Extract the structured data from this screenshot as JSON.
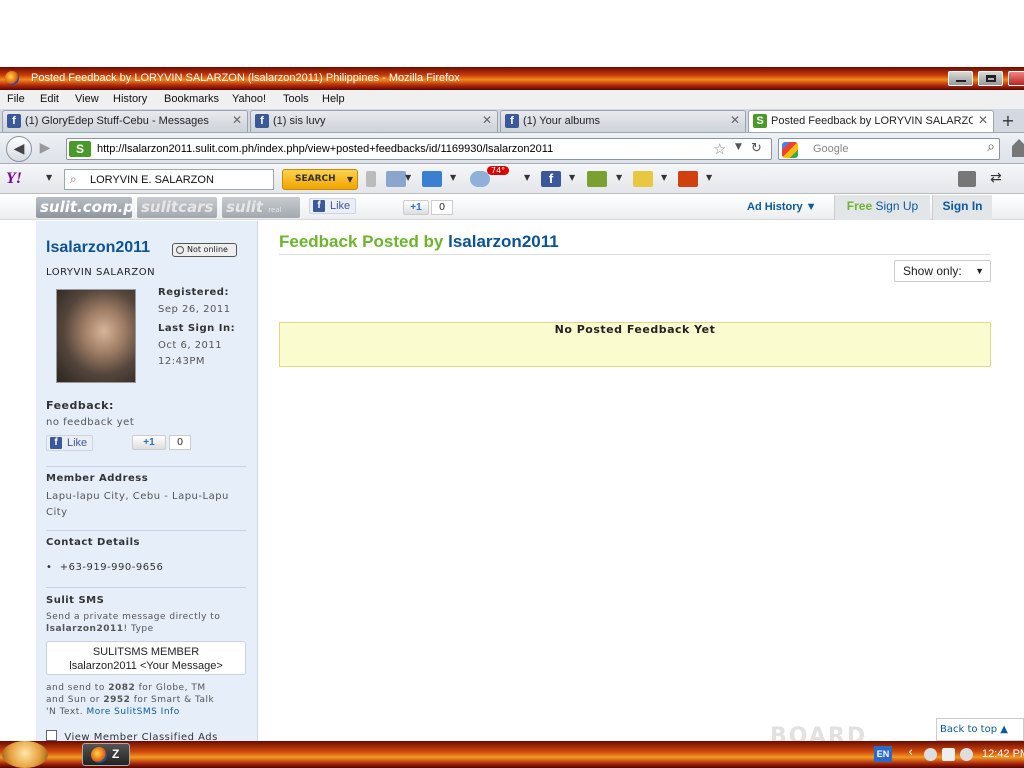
{
  "window": {
    "title": "Posted Feedback by LORYVIN SALARZON (lsalarzon2011) Philippines - Mozilla Firefox"
  },
  "menu": [
    "File",
    "Edit",
    "View",
    "History",
    "Bookmarks",
    "Yahoo!",
    "Tools",
    "Help"
  ],
  "tabs": [
    {
      "label": "(1) GloryEdep Stuff-Cebu - Messages",
      "icon": "facebook-icon"
    },
    {
      "label": "(1) sis luvy",
      "icon": "facebook-icon"
    },
    {
      "label": "(1) Your albums",
      "icon": "facebook-icon"
    },
    {
      "label": "Posted Feedback by LORYVIN SALARZO",
      "icon": "sulit-icon",
      "active": true
    }
  ],
  "nav": {
    "url": "http://lsalarzon2011.sulit.com.ph/index.php/view+posted+feedbacks/id/1169930/lsalarzon2011",
    "search_placeholder": "Google"
  },
  "yahoo_toolbar": {
    "logo": "Y!",
    "search_value": "LORYVIN E. SALARZON",
    "search_button": "SEARCH",
    "weather_badge": "74°"
  },
  "site_header": {
    "logo_main": "sulit.com.ph",
    "logo_cars": "sulitcars",
    "logo_realestate": "sulit",
    "logo_realestate_small": "real estate",
    "like_label": "Like",
    "plus_one": "+1",
    "plus_count": "0",
    "ad_history": "Ad History ▼",
    "free": "Free",
    "sign_up": "Sign Up",
    "sign_in": "Sign In"
  },
  "sidebar": {
    "username": "lsalarzon2011",
    "status": "Not online",
    "real_name": "LORYVIN SALARZON",
    "registered_label": "Registered:",
    "registered_value": "Sep 26, 2011",
    "last_signin_label": "Last Sign In:",
    "last_signin_date": "Oct 6, 2011",
    "last_signin_time": "12:43PM",
    "feedback_label": "Feedback:",
    "feedback_value": "no feedback yet",
    "like_label": "Like",
    "plus_one": "+1",
    "plus_count": "0",
    "address_label": "Member Address",
    "address_line1": "Lapu-lapu City, Cebu - Lapu-Lapu",
    "address_line2": "City",
    "contact_label": "Contact Details",
    "phone": "+63-919-990-9656",
    "sms_label": "Sulit SMS",
    "sms_desc1": "Send a private message directly to",
    "sms_desc2_user": "lsalarzon2011",
    "sms_desc2_rest": "! Type",
    "sms_box_line1": "SULITSMS MEMBER",
    "sms_box_line2": "lsalarzon2011 <Your Message>",
    "sms_send1_a": "and send to ",
    "sms_send1_num": "2082",
    "sms_send1_b": " for Globe, TM",
    "sms_send2_a": "and Sun or ",
    "sms_send2_num": "2952",
    "sms_send2_b": " for Smart & Talk",
    "sms_send3_a": "'N Text. ",
    "sms_more": "More SulitSMS Info",
    "view_ads": "View Member Classified Ads"
  },
  "main": {
    "title_prefix": "Feedback Posted by ",
    "title_user": "lsalarzon2011",
    "show_only": "Show only:",
    "no_feedback": "No Posted Feedback Yet",
    "back_to_top": "Back to top ▲",
    "watermark": "BOARD"
  },
  "taskbar": {
    "app_label": "Z",
    "lang": "EN",
    "clock": "12:42 PM"
  }
}
